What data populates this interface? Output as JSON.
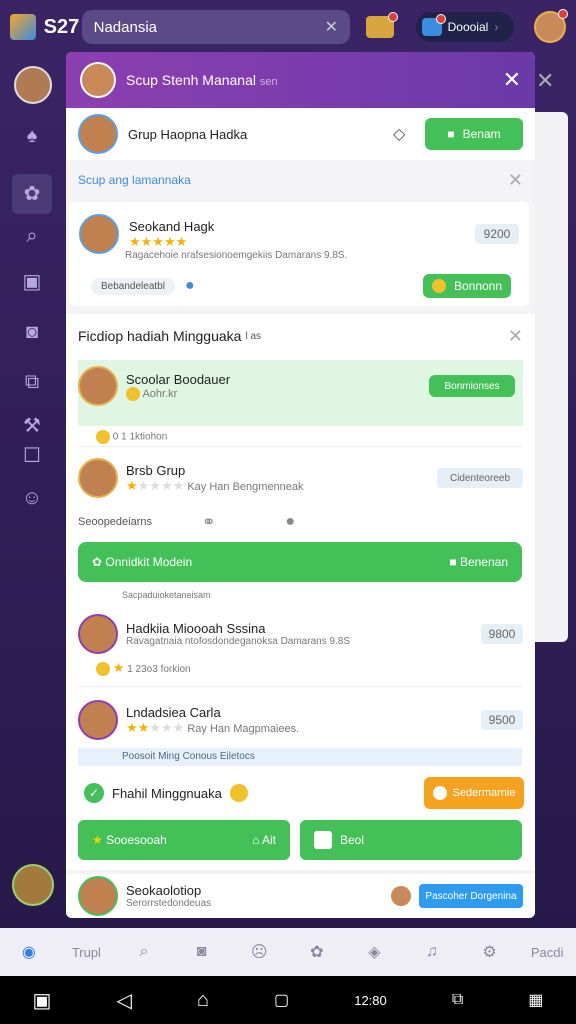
{
  "topbar": {
    "number": "S27",
    "search_value": "Nadansia",
    "pill_label": "Doooial"
  },
  "modal": {
    "header_title": "Scup Stenh Mananal",
    "header_subtitle": "sen",
    "group_card": {
      "title": "Grup Haopna Hadka",
      "button": "Benam"
    },
    "section_label": "Scup ang lamannaka",
    "top_entry": {
      "name": "Seokand Hagk",
      "desc": "Ragacehoie nrafsesionoemgekiis Damarans 9.8S.",
      "chip": "Bebandeleatbl",
      "price": "9200",
      "button": "Bonnonn"
    },
    "weekly": {
      "title": "Ficdiop hadiah Mingguaka",
      "title_suffix": "l as",
      "items": [
        {
          "name": "Scoolar Boodauer",
          "sub": "Aohr.kr",
          "meta": "0 1 1ktiohon",
          "button": "Bonmionses",
          "highlight": true
        },
        {
          "name": "Brsb Grup",
          "sub": "Kay Han Bengmenneak",
          "meta": "Seoopedeiarns",
          "button": "Cidenteoreeb",
          "highlight": false
        }
      ],
      "wide_button": {
        "left": "Onnidkit Modein",
        "right": "Benenan"
      },
      "sub_caption": "Sacpaduioketaneisam",
      "items2": [
        {
          "name": "Hadkiia Mioooah Sssina",
          "desc": "Ravagatnaia ntofosdondeganoksa Damarans 9.8S",
          "meta": "1 23o3 forkion",
          "price": "9800"
        },
        {
          "name": "Lndadsiea Carla",
          "sub": "Ray Han Magpmaiees.",
          "price": "9500"
        }
      ],
      "notice": "Poosoit Ming Conous Eiletocs",
      "check_label": "Fhahil Minggnuaka",
      "orange_button": "Sedermarnie",
      "bottom_left_button": "Sooesooah",
      "bottom_left_button2": "Ait",
      "bottom_right_button": "Beol"
    },
    "footer_entry": {
      "name": "Seokaolotiop",
      "sub": "Serorrstedondeuas",
      "button": "Pascoher Dorgenina"
    }
  },
  "nav": {
    "left_label": "Trupl",
    "right_label": "Pacdi"
  },
  "system": {
    "time": "12:80"
  }
}
